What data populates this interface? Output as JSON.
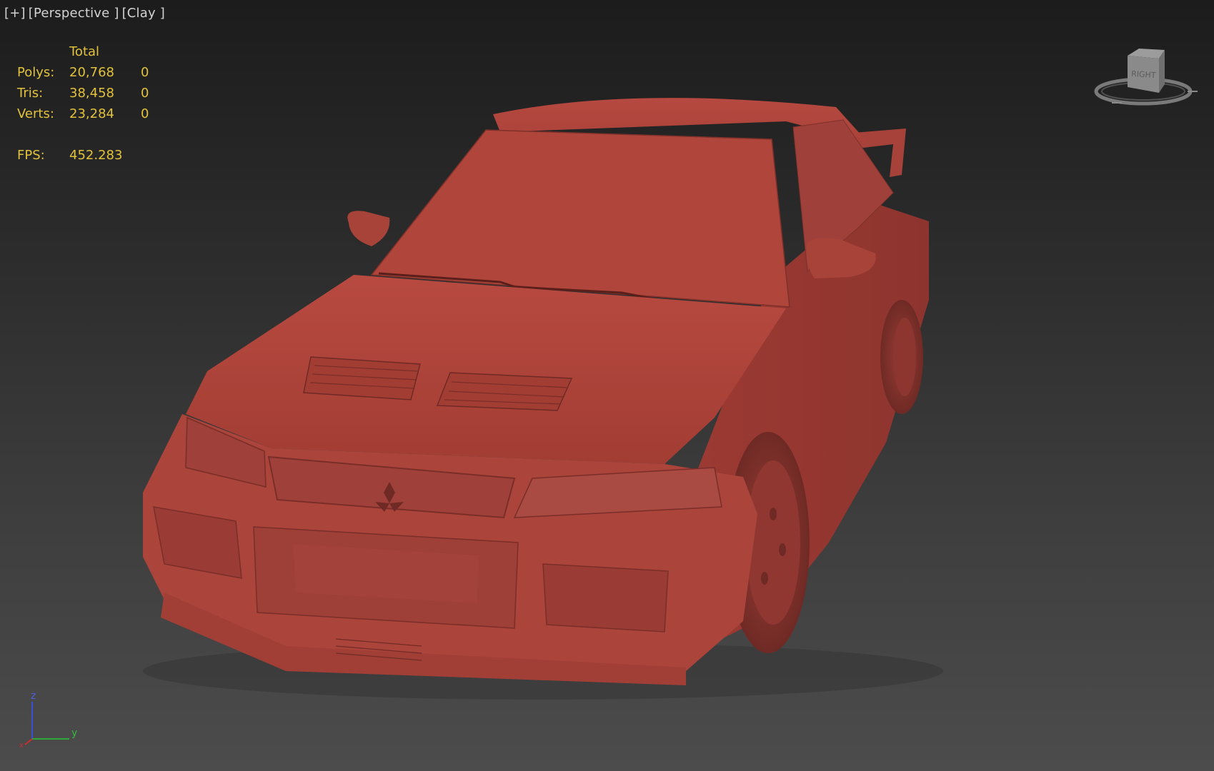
{
  "viewport": {
    "label_plus": "[+]",
    "label_view": "[Perspective ]",
    "label_shading": "[Clay ]",
    "background_top": "#1c1c1c",
    "background_bottom": "#4c4c4c"
  },
  "stats": {
    "header": "Total",
    "rows": [
      {
        "label": "Polys:",
        "value": "20,768",
        "selected": "0"
      },
      {
        "label": "Tris:",
        "value": "38,458",
        "selected": "0"
      },
      {
        "label": "Verts:",
        "value": "23,284",
        "selected": "0"
      }
    ],
    "fps_label": "FPS:",
    "fps_value": "452.283",
    "color": "#e2c23c"
  },
  "viewcube": {
    "face_label": "RIGHT",
    "icon": "viewcube-icon"
  },
  "axis": {
    "z": "z",
    "y": "y",
    "x": "x"
  },
  "model": {
    "description_icon": "car-model",
    "clay_color": "#b8473f"
  }
}
